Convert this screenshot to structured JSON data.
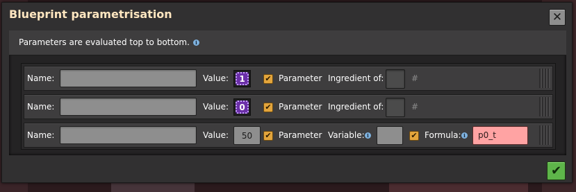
{
  "window": {
    "title": "Blueprint parametrisation",
    "close_glyph": "✕"
  },
  "info": {
    "text": "Parameters are evaluated top to bottom.",
    "icon": "info-icon",
    "icon_glyph": "i"
  },
  "labels": {
    "name": "Name:",
    "value": "Value:",
    "parameter": "Parameter",
    "ingredient_of": "Ingredient of:",
    "variable": "Variable:",
    "formula": "Formula:",
    "hash": "#"
  },
  "rows": [
    {
      "name": "",
      "value": "1",
      "value_kind": "signal",
      "parameter_checked": true,
      "check_glyph": "✔"
    },
    {
      "name": "",
      "value": "0",
      "value_kind": "signal",
      "parameter_checked": true,
      "check_glyph": "✔"
    },
    {
      "name": "",
      "value": "50",
      "value_kind": "number",
      "parameter_checked": true,
      "check_glyph": "✔",
      "formula_checked": true,
      "formula": "p0_t"
    }
  ],
  "confirm": {
    "glyph": "✔"
  },
  "colors": {
    "title": "#ffe6c0",
    "signal": "#6b2fa8",
    "checkbox": "#e3a53c",
    "formula_error": "#ffa3a3",
    "confirm": "#5eb54a"
  }
}
